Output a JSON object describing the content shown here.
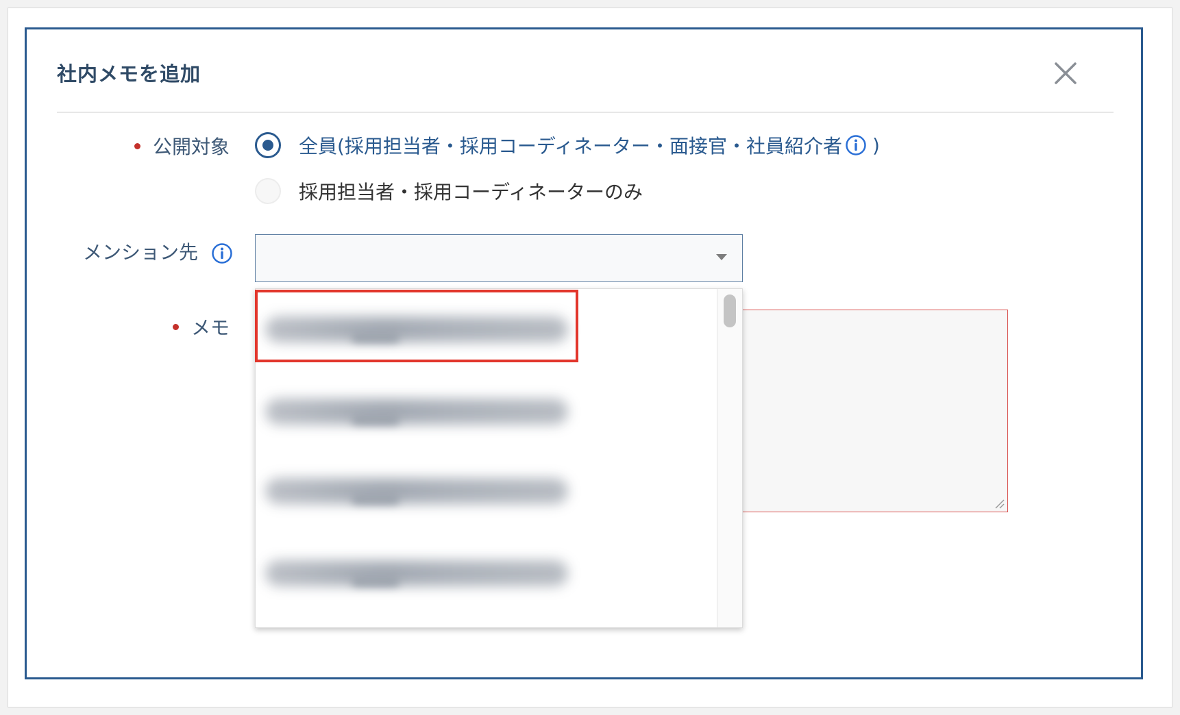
{
  "dialog": {
    "title": "社内メモを追加",
    "close_icon": "close-icon"
  },
  "visibility": {
    "label": "公開対象",
    "required": true,
    "options": [
      {
        "label": "全員(採用担当者・採用コーディネーター・面接官・社員紹介者",
        "suffix": " )",
        "selected": true,
        "has_info": true
      },
      {
        "label": "採用担当者・採用コーディネーターのみ",
        "selected": false,
        "has_info": false
      }
    ]
  },
  "mention": {
    "label": "メンション先",
    "info_icon": "info-icon",
    "value": "",
    "dropdown_open": true,
    "options_count_visible": 4,
    "options_text": "blurred"
  },
  "memo": {
    "label": "メモ",
    "required": true,
    "value": "",
    "state": "error"
  },
  "colors": {
    "accent": "#2a5a8f",
    "label": "#3d5876",
    "required_dot": "#c4312b",
    "highlight": "#e2362c",
    "error_border": "#d9524f"
  }
}
